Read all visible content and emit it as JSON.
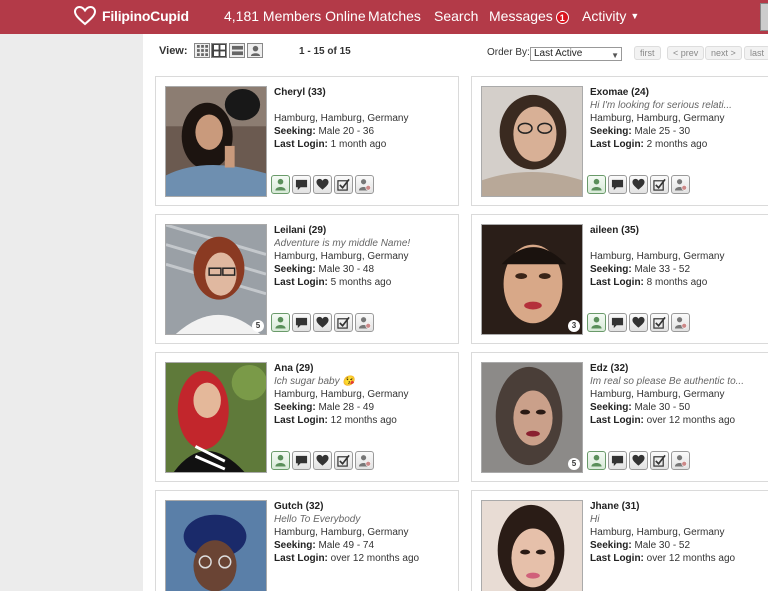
{
  "header": {
    "logo_text": "FilipinoCupid",
    "members_online": "4,181 Members Online",
    "nav": {
      "matches": "Matches",
      "search": "Search",
      "messages": "Messages",
      "messages_badge": "1",
      "activity": "Activity"
    }
  },
  "toolbar": {
    "view_label": "View:",
    "result_count": "1 - 15 of 15",
    "order_by_label": "Order By:",
    "order_by_value": "Last Active",
    "pager": {
      "first": "first",
      "prev": "< prev",
      "next": "next >",
      "last": "last"
    }
  },
  "labels": {
    "seeking": "Seeking:",
    "last_login": "Last Login:"
  },
  "colors": {
    "header_bg": "#b33a48",
    "badge": "#d9131e"
  },
  "profiles": [
    {
      "name": "Cheryl (33)",
      "tagline": "",
      "location": "Hamburg, Hamburg, Germany",
      "seeking": "Male 20 - 36",
      "last_login": "1 month ago",
      "photo_count": ""
    },
    {
      "name": "Exomae (24)",
      "tagline": "Hi I'm looking for serious relati...",
      "location": "Hamburg, Hamburg, Germany",
      "seeking": "Male 25 - 30",
      "last_login": "2 months ago",
      "photo_count": ""
    },
    {
      "name": "Leilani (29)",
      "tagline": "Adventure is my middle Name!",
      "location": "Hamburg, Hamburg, Germany",
      "seeking": "Male 30 - 48",
      "last_login": "5 months ago",
      "photo_count": "5"
    },
    {
      "name": "aileen (35)",
      "tagline": "",
      "location": "Hamburg, Hamburg, Germany",
      "seeking": "Male 33 - 52",
      "last_login": "8 months ago",
      "photo_count": "3"
    },
    {
      "name": "Ana (29)",
      "tagline": "Ich sugar baby 😘",
      "location": "Hamburg, Hamburg, Germany",
      "seeking": "Male 28 - 49",
      "last_login": "12 months ago",
      "photo_count": ""
    },
    {
      "name": "Edz (32)",
      "tagline": "Im real so please Be authentic to...",
      "location": "Hamburg, Hamburg, Germany",
      "seeking": "Male 30 - 50",
      "last_login": "over 12 months ago",
      "photo_count": "5"
    },
    {
      "name": "Gutch (32)",
      "tagline": "Hello To Everybody",
      "location": "Hamburg, Hamburg, Germany",
      "seeking": "Male 49 - 74",
      "last_login": "over 12 months ago",
      "photo_count": ""
    },
    {
      "name": "Jhane (31)",
      "tagline": "Hi",
      "location": "Hamburg, Hamburg, Germany",
      "seeking": "Male 30 - 52",
      "last_login": "over 12 months ago",
      "photo_count": ""
    }
  ]
}
